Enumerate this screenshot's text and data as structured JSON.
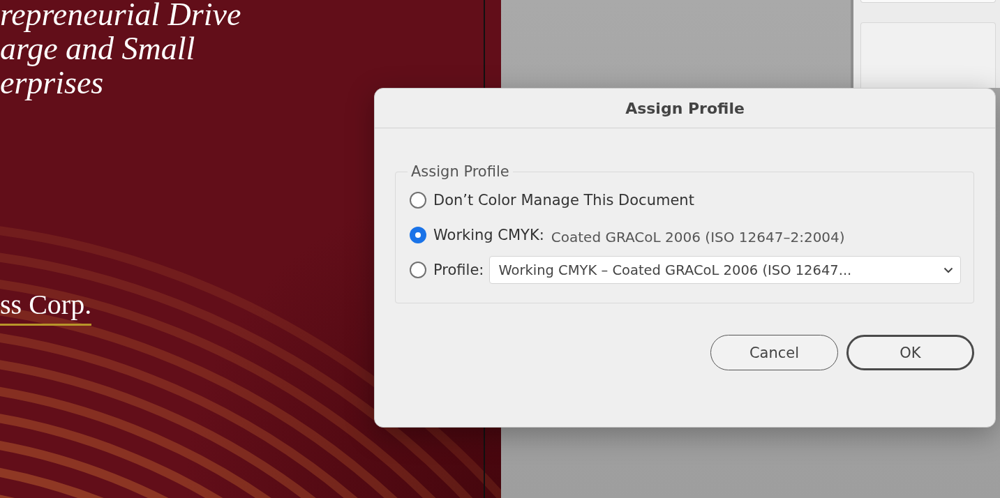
{
  "document": {
    "headline_lines": [
      "repreneurial Drive",
      "arge and Small",
      "erprises"
    ],
    "company": "ss Corp."
  },
  "dialog": {
    "title": "Assign Profile",
    "group_title": "Assign Profile",
    "options": [
      {
        "kind": "plain",
        "label": "Don’t Color Manage This Document",
        "selected": false
      },
      {
        "kind": "value",
        "label": "Working CMYK:",
        "value": "Coated GRACoL 2006 (ISO 12647–2:2004)",
        "selected": true
      },
      {
        "kind": "dropdown",
        "label": "Profile:",
        "value": "Working CMYK – Coated GRACoL 2006 (ISO 12647...",
        "selected": false
      }
    ],
    "buttons": [
      {
        "label": "Cancel",
        "default": false
      },
      {
        "label": "OK",
        "default": true
      }
    ]
  }
}
